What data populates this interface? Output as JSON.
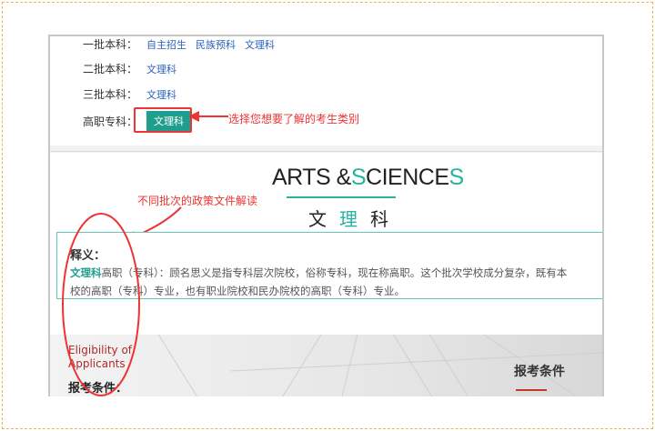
{
  "batches": [
    {
      "label": "一批本科：",
      "links": [
        "自主招生",
        "民族预科",
        "文理科"
      ]
    },
    {
      "label": "二批本科：",
      "links": [
        "文理科"
      ]
    },
    {
      "label": "三批本科：",
      "links": [
        "文理科"
      ]
    },
    {
      "label": "高职专科：",
      "button": "文理科"
    }
  ],
  "annotations": {
    "choose": "选择您想要了解的考生类别",
    "policy": "不同批次的政策文件解读"
  },
  "logo": {
    "part1": "ARTS &",
    "s1": "S",
    "part2": "CIENCE",
    "s2": "S",
    "cn1": "文",
    "cn2": "理",
    "cn3": "科"
  },
  "definition": {
    "title": "释义：",
    "term": "文理科",
    "line1": "高职（专科）：顾名思义是指专科层次院校，俗称专科，现在称高职。这个批次学校成分复杂，既有本",
    "line2": "校的高职（专科）专业，也有职业院校和民办院校的高职（专科）专业。"
  },
  "requirements": {
    "en_line1": "Eligibility of",
    "en_line2": "Applicants",
    "cn_left": "报考条件：",
    "cn_right": "报考条件"
  },
  "colors": {
    "teal": "#1f9e8e",
    "annotation_red": "#e33333",
    "link_blue": "#2a62b8"
  }
}
